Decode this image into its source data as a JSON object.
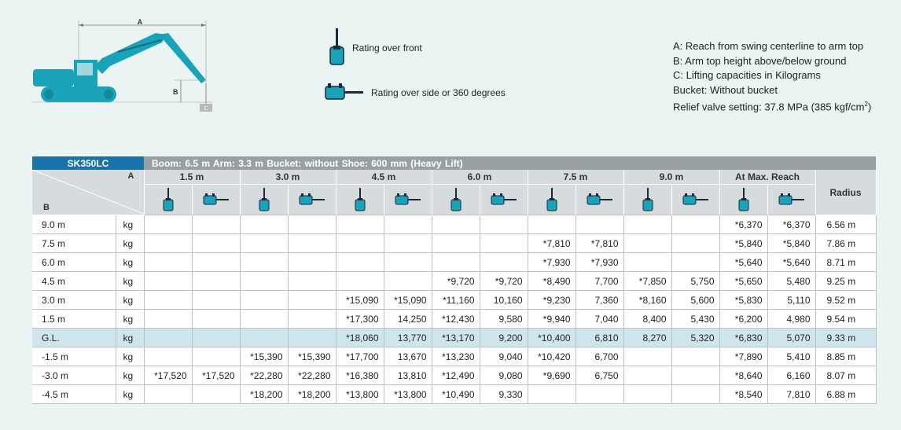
{
  "diagram": {
    "label_a": "A",
    "label_b": "B",
    "label_c": "C"
  },
  "legend": {
    "front": "Rating over front",
    "side": "Rating over side or 360 degrees"
  },
  "notes": {
    "a": "A: Reach from swing centerline to arm top",
    "b": "B: Arm top height above/below ground",
    "c": "C: Lifting capacities in Kilograms",
    "bucket": "Bucket: Without bucket",
    "relief_prefix": "Relief valve setting: 37.8 MPa (385 kgf/cm",
    "relief_sup": "2",
    "relief_suffix": ")"
  },
  "colors": {
    "accent": "#1a73a8",
    "header_gray": "#98a0a3",
    "subheader": "#d6dbdd",
    "gl_row": "#cfe5ee",
    "icon": "#1aa3b8"
  },
  "table": {
    "model": "SK350LC",
    "spec": "Boom: 6.5 m   Arm: 3.3 m   Bucket: without   Shoe: 600 mm (Heavy Lift)",
    "corner_a": "A",
    "corner_b": "B",
    "reach_columns": [
      "1.5 m",
      "3.0 m",
      "4.5 m",
      "6.0 m",
      "7.5 m",
      "9.0 m",
      "At Max. Reach"
    ],
    "radius_header": "Radius",
    "rows": [
      {
        "h": "9.0 m",
        "u": "kg",
        "v": [
          "",
          "",
          "",
          "",
          "",
          "",
          "",
          "",
          "",
          "",
          "",
          "",
          "*6,370",
          "*6,370"
        ],
        "r": "6.56 m"
      },
      {
        "h": "7.5 m",
        "u": "kg",
        "v": [
          "",
          "",
          "",
          "",
          "",
          "",
          "",
          "",
          "*7,810",
          "*7,810",
          "",
          "",
          "*5,840",
          "*5,840"
        ],
        "r": "7.86 m"
      },
      {
        "h": "6.0 m",
        "u": "kg",
        "v": [
          "",
          "",
          "",
          "",
          "",
          "",
          "",
          "",
          "*7,930",
          "*7,930",
          "",
          "",
          "*5,640",
          "*5,640"
        ],
        "r": "8.71 m"
      },
      {
        "h": "4.5 m",
        "u": "kg",
        "v": [
          "",
          "",
          "",
          "",
          "",
          "",
          "*9,720",
          "*9,720",
          "*8,490",
          "7,700",
          "*7,850",
          "5,750",
          "*5,650",
          "5,480"
        ],
        "r": "9.25 m"
      },
      {
        "h": "3.0 m",
        "u": "kg",
        "v": [
          "",
          "",
          "",
          "",
          "*15,090",
          "*15,090",
          "*11,160",
          "10,160",
          "*9,230",
          "7,360",
          "*8,160",
          "5,600",
          "*5,830",
          "5,110"
        ],
        "r": "9.52 m"
      },
      {
        "h": "1.5 m",
        "u": "kg",
        "v": [
          "",
          "",
          "",
          "",
          "*17,300",
          "14,250",
          "*12,430",
          "9,580",
          "*9,940",
          "7,040",
          "8,400",
          "5,430",
          "*6,200",
          "4,980"
        ],
        "r": "9.54 m"
      },
      {
        "h": "G.L.",
        "u": "kg",
        "v": [
          "",
          "",
          "",
          "",
          "*18,060",
          "13,770",
          "*13,170",
          "9,200",
          "*10,400",
          "6,810",
          "8,270",
          "5,320",
          "*6,830",
          "5,070"
        ],
        "r": "9.33 m"
      },
      {
        "h": "-1.5 m",
        "u": "kg",
        "v": [
          "",
          "",
          "*15,390",
          "*15,390",
          "*17,700",
          "13,670",
          "*13,230",
          "9,040",
          "*10,420",
          "6,700",
          "",
          "",
          "*7,890",
          "5,410"
        ],
        "r": "8.85 m"
      },
      {
        "h": "-3.0 m",
        "u": "kg",
        "v": [
          "*17,520",
          "*17,520",
          "*22,280",
          "*22,280",
          "*16,380",
          "13,810",
          "*12,490",
          "9,080",
          "*9,690",
          "6,750",
          "",
          "",
          "*8,640",
          "6,160"
        ],
        "r": "8.07 m"
      },
      {
        "h": "-4.5 m",
        "u": "kg",
        "v": [
          "",
          "",
          "*18,200",
          "*18,200",
          "*13,800",
          "*13,800",
          "*10,490",
          "9,330",
          "",
          "",
          "",
          "",
          "*8,540",
          "7,810"
        ],
        "r": "6.88 m"
      }
    ]
  }
}
